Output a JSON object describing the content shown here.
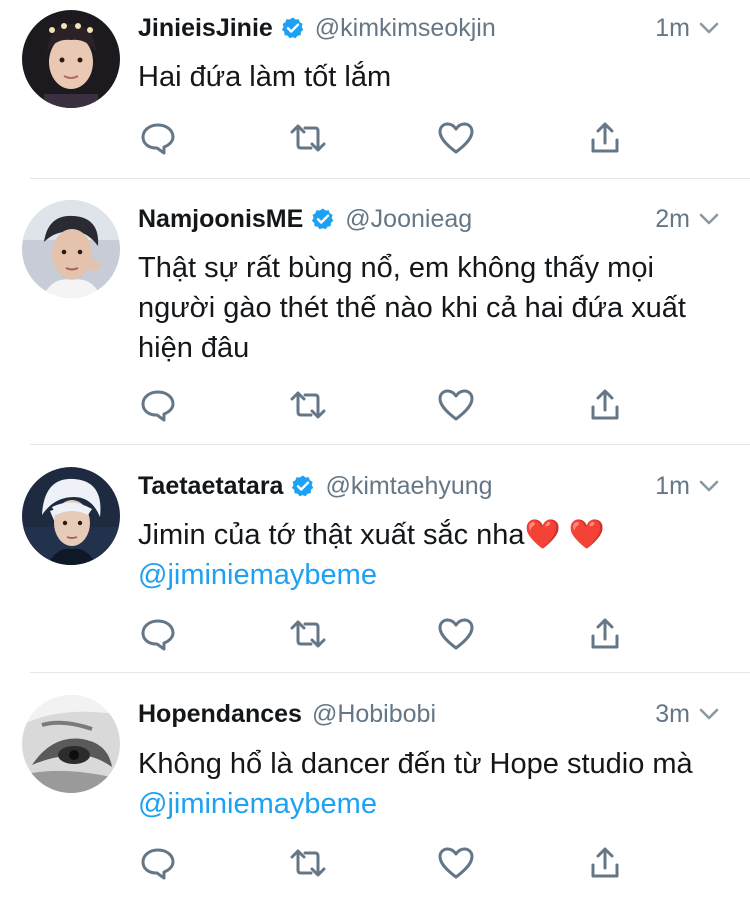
{
  "tweets": [
    {
      "name": "JinieisJinie",
      "handle": "@kimkimseokjin",
      "verified": true,
      "time": "1m",
      "text": "Hai đứa làm tốt lắm",
      "mention": ""
    },
    {
      "name": "NamjoonisME",
      "handle": "@Joonieag",
      "verified": true,
      "time": "2m",
      "text": "Thật sự rất bùng nổ, em không thấy mọi người gào thét thế nào khi cả hai đứa xuất hiện đâu",
      "mention": ""
    },
    {
      "name": "Taetaetatara",
      "handle": "@kimtaehyung",
      "verified": true,
      "time": "1m",
      "text": "Jimin của tớ thật xuất sắc nha",
      "hearts": "❤️ ❤️",
      "mention": "@jiminiemaybeme"
    },
    {
      "name": "Hopendances",
      "handle": "@Hobibobi",
      "verified": false,
      "time": "3m",
      "text": "Không hổ là dancer đến từ Hope studio mà",
      "mention": "@jiminiemaybeme"
    }
  ],
  "icons": {
    "reply": "reply-icon",
    "retweet": "retweet-icon",
    "like": "heart-icon",
    "share": "share-icon",
    "verified": "verified-badge-icon",
    "caret": "chevron-down-icon"
  },
  "colors": {
    "verified": "#1da1f2",
    "mention": "#1da1f2",
    "secondary_text": "#657786",
    "icon_gray": "#657786",
    "divider": "#e1e8ed"
  }
}
